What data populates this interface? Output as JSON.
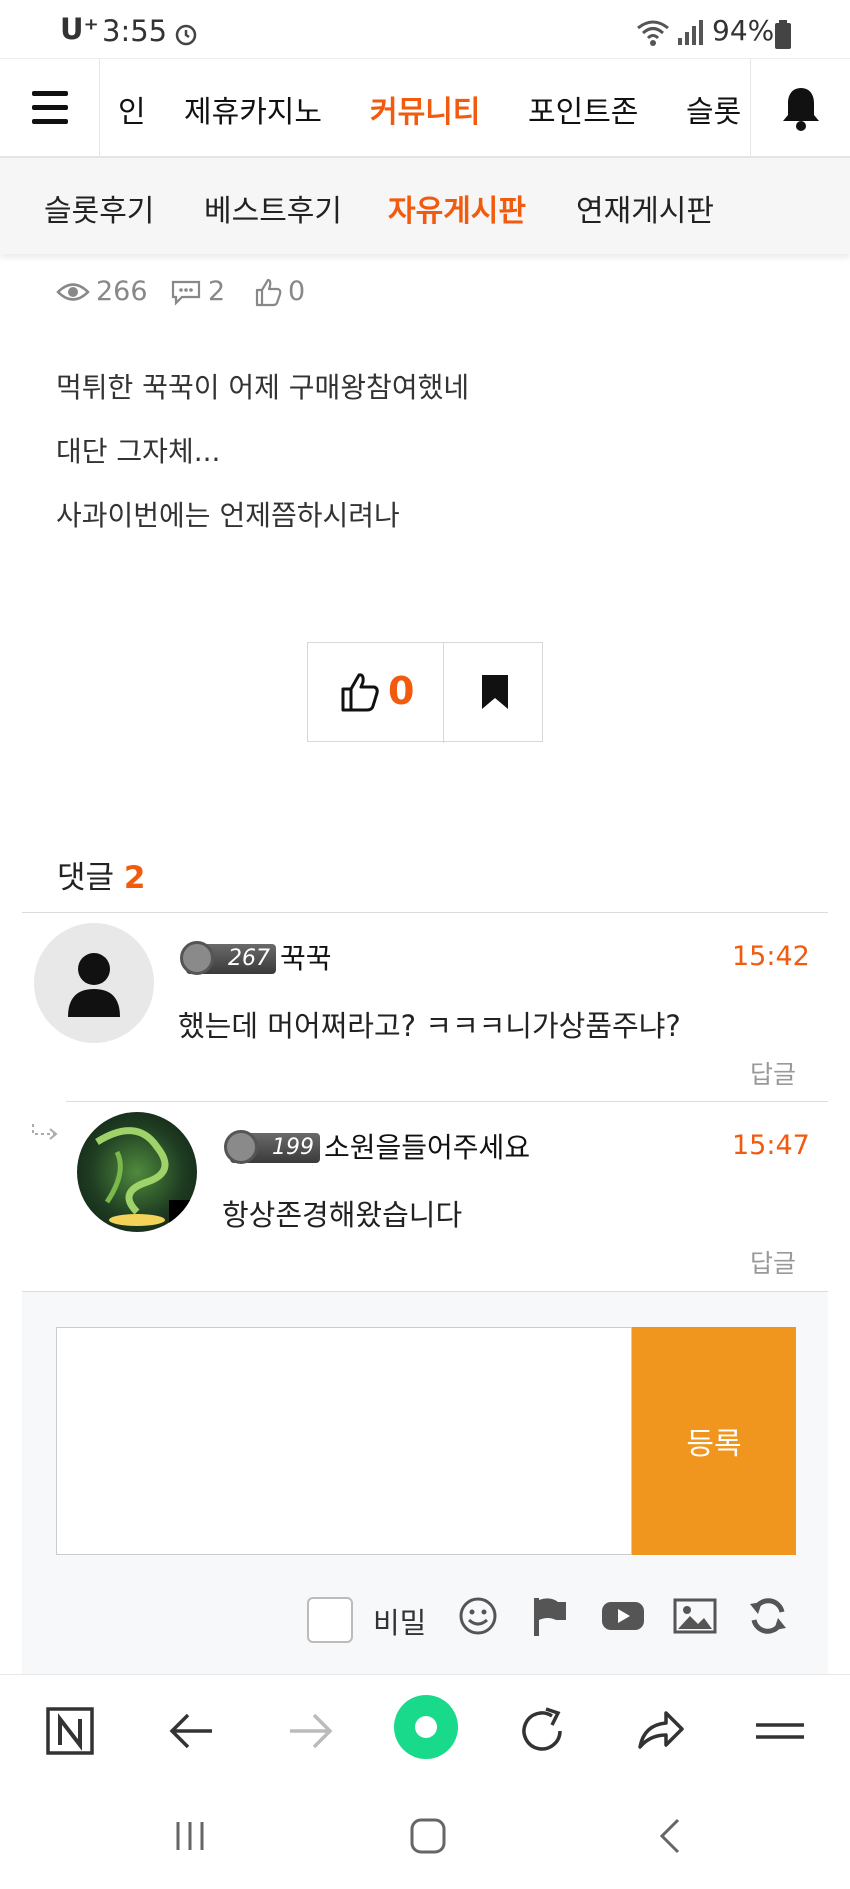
{
  "status_bar": {
    "carrier": "U⁺",
    "time": "3:55",
    "battery": "94%"
  },
  "top_nav": {
    "items": [
      "인",
      "제휴카지노",
      "커뮤니티",
      "포인트존",
      "슬롯"
    ],
    "active_index": 2
  },
  "sub_nav": {
    "items": [
      "슬롯후기",
      "베스트후기",
      "자유게시판",
      "연재게시판"
    ],
    "active_index": 2
  },
  "post": {
    "views": "266",
    "comments": "2",
    "likes": "0",
    "lines": [
      "먹튀한 꾹꾹이 어제 구매왕참여했네",
      "대단 그자체...",
      "사과이번에는 언제쯤하시려나"
    ],
    "like_count": "0"
  },
  "comments": {
    "title": "댓글",
    "count": "2",
    "items": [
      {
        "level": "267",
        "name": "꾹꾹",
        "time": "15:42",
        "text": "했는데 머어쩌라고? ㅋㅋㅋ니가상품주냐?",
        "reply": "답글",
        "avatar": "default-user-icon"
      },
      {
        "level": "199",
        "name": "소원을들어주세요",
        "time": "15:47",
        "text": "항상존경해왔습니다",
        "reply": "답글",
        "avatar": "dragon-image"
      }
    ]
  },
  "write": {
    "submit_label": "등록",
    "secret_label": "비밀"
  },
  "colors": {
    "accent": "#f25a0d",
    "submit": "#f0961e",
    "browser_green": "#19d98b"
  }
}
